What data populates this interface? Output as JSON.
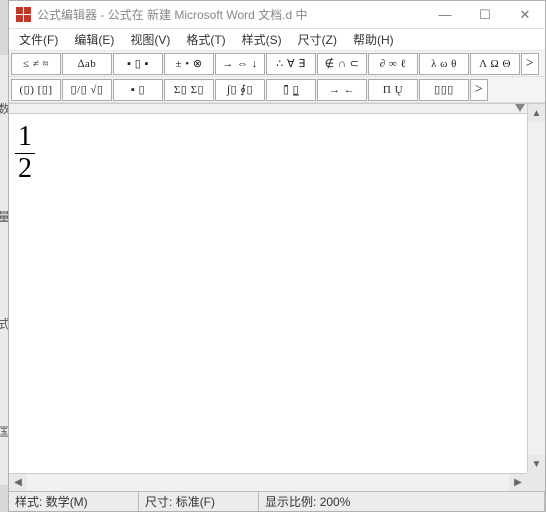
{
  "title": "公式编辑器 - 公式在 新建 Microsoft Word 文档.d 中",
  "menu": {
    "file": "文件(F)",
    "edit": "编辑(E)",
    "view": "视图(V)",
    "format": "格式(T)",
    "style": "样式(S)",
    "size": "尺寸(Z)",
    "help": "帮助(H)"
  },
  "toolbar": {
    "row1": {
      "relations": "≤ ≠ ≈",
      "spaces": "∆ab",
      "embellish": "▪ ▯ ▪",
      "operators": "± • ⊗",
      "arrows": "→ ⇔ ↓",
      "logic": "∴ ∀ ∃",
      "set": "∉ ∩ ⊂",
      "misc": "∂ ∞ ℓ",
      "greek_l": "λ ω θ",
      "greek_u": "Λ Ω Θ",
      "more": ">"
    },
    "row2": {
      "fence": "(▯) [▯]",
      "frac": "▯/▯ √▯",
      "script": "▪ ▯",
      "sum": "Σ▯ Σ▯",
      "integral": "∫▯ ∮▯",
      "bar": "▯̄ ▯̲",
      "arrow2": "→ ←",
      "prod": "Π Ų",
      "matrix": "▯▯▯",
      "more": ">"
    }
  },
  "equation": {
    "numerator": "1",
    "denominator": "2"
  },
  "status": {
    "style_label": "样式:",
    "style_value": "数学(M)",
    "size_label": "尺寸:",
    "size_value": "标准(F)",
    "zoom_label": "显示比例:",
    "zoom_value": "200%"
  },
  "sidecut": {
    "a": "数",
    "b": "量",
    "c": "式",
    "d": "国"
  }
}
